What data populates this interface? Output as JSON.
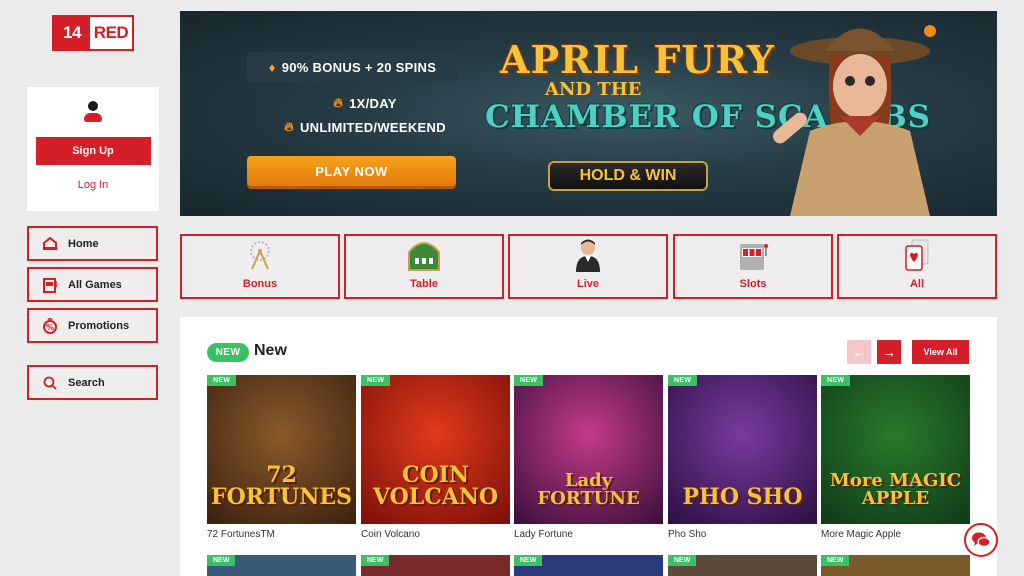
{
  "logo": {
    "num": "14",
    "text": "RED"
  },
  "auth": {
    "signup": "Sign Up",
    "login": "Log In"
  },
  "nav": [
    {
      "label": "Home",
      "icon": "home-icon"
    },
    {
      "label": "All Games",
      "icon": "slot-machine-icon"
    },
    {
      "label": "Promotions",
      "icon": "promo-icon"
    }
  ],
  "search": {
    "label": "Search"
  },
  "banner": {
    "pill": "90% BONUS + 20 SPINS",
    "line1": "1X/DAY",
    "line2": "UNLIMITED/WEEKEND",
    "play": "PLAY NOW",
    "title_a": "APRIL FURY",
    "title_b": "AND THE",
    "title_c": "CHAMBER OF SCARABS",
    "hold_win": "HOLD & WIN"
  },
  "categories": [
    {
      "label": "Bonus",
      "icon": "bonus-icon"
    },
    {
      "label": "Table",
      "icon": "table-icon"
    },
    {
      "label": "Live",
      "icon": "live-dealer-icon"
    },
    {
      "label": "Slots",
      "icon": "slots-icon"
    },
    {
      "label": "All",
      "icon": "cards-icon"
    }
  ],
  "section": {
    "tag": "NEW",
    "title": "New",
    "view_all": "View All"
  },
  "games": [
    {
      "name": "72 FortunesTM",
      "badge": "NEW",
      "art": "72 FORTUNES",
      "colors": [
        "#8a5a2a",
        "#3a2010"
      ]
    },
    {
      "name": "Coin Volcano",
      "badge": "NEW",
      "art": "COIN VOLCANO",
      "colors": [
        "#e23a1a",
        "#7a0f0a"
      ]
    },
    {
      "name": "Lady Fortune",
      "badge": "NEW",
      "art": "Lady FORTUNE",
      "colors": [
        "#c43a8a",
        "#3a0f3a"
      ]
    },
    {
      "name": "Pho Sho",
      "badge": "NEW",
      "art": "PHO SHO",
      "colors": [
        "#7a3aa0",
        "#2a1040"
      ]
    },
    {
      "name": "More Magic Apple",
      "badge": "NEW",
      "art": "More MAGIC APPLE",
      "colors": [
        "#2a7a2a",
        "#0f3a1a"
      ]
    }
  ],
  "next_row": [
    "NEW",
    "NEW",
    "NEW",
    "NEW",
    "NEW"
  ],
  "colors": {
    "brand": "#d41f28",
    "new_green": "#3cc065"
  }
}
